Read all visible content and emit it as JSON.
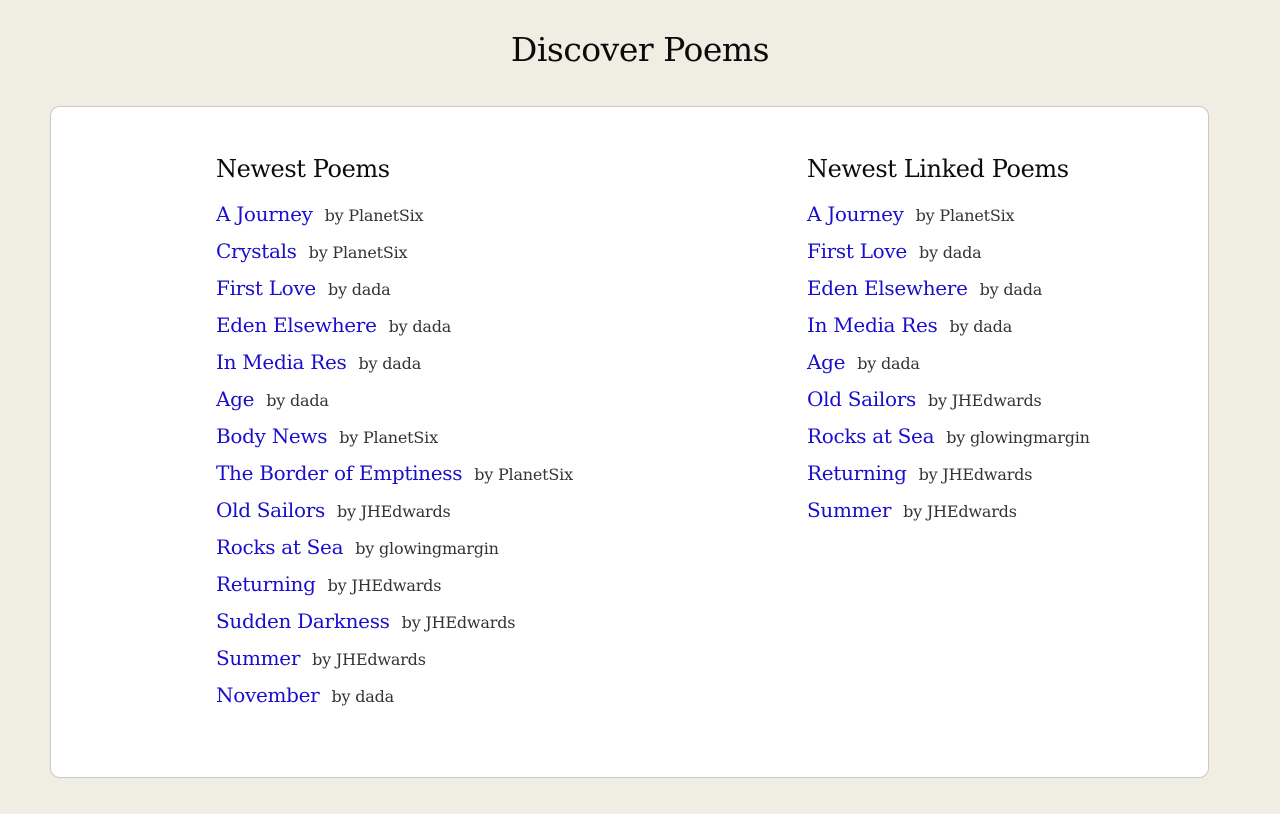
{
  "page": {
    "title": "Discover Poems"
  },
  "newest": {
    "heading": "Newest Poems",
    "items": [
      {
        "title": "A Journey",
        "author": "by PlanetSix"
      },
      {
        "title": "Crystals",
        "author": "by PlanetSix"
      },
      {
        "title": "First Love",
        "author": "by dada"
      },
      {
        "title": "Eden Elsewhere",
        "author": "by dada"
      },
      {
        "title": "In Media Res",
        "author": "by dada"
      },
      {
        "title": "Age",
        "author": "by dada"
      },
      {
        "title": "Body News",
        "author": "by PlanetSix"
      },
      {
        "title": "The Border of Emptiness",
        "author": "by PlanetSix"
      },
      {
        "title": "Old Sailors",
        "author": "by JHEdwards"
      },
      {
        "title": "Rocks at Sea",
        "author": "by glowingmargin"
      },
      {
        "title": "Returning",
        "author": "by JHEdwards"
      },
      {
        "title": "Sudden Darkness",
        "author": "by JHEdwards"
      },
      {
        "title": "Summer",
        "author": "by JHEdwards"
      },
      {
        "title": "November",
        "author": "by dada"
      }
    ]
  },
  "linked": {
    "heading": "Newest Linked Poems",
    "items": [
      {
        "title": "A Journey",
        "author": "by PlanetSix"
      },
      {
        "title": "First Love",
        "author": "by dada"
      },
      {
        "title": "Eden Elsewhere",
        "author": "by dada"
      },
      {
        "title": "In Media Res",
        "author": "by dada"
      },
      {
        "title": "Age",
        "author": "by dada"
      },
      {
        "title": "Old Sailors",
        "author": "by JHEdwards"
      },
      {
        "title": "Rocks at Sea",
        "author": "by glowingmargin"
      },
      {
        "title": "Returning",
        "author": "by JHEdwards"
      },
      {
        "title": "Summer",
        "author": "by JHEdwards"
      }
    ]
  },
  "colors": {
    "background": "#f0eee3",
    "card": "#ffffff",
    "link": "#1a0dcc"
  }
}
